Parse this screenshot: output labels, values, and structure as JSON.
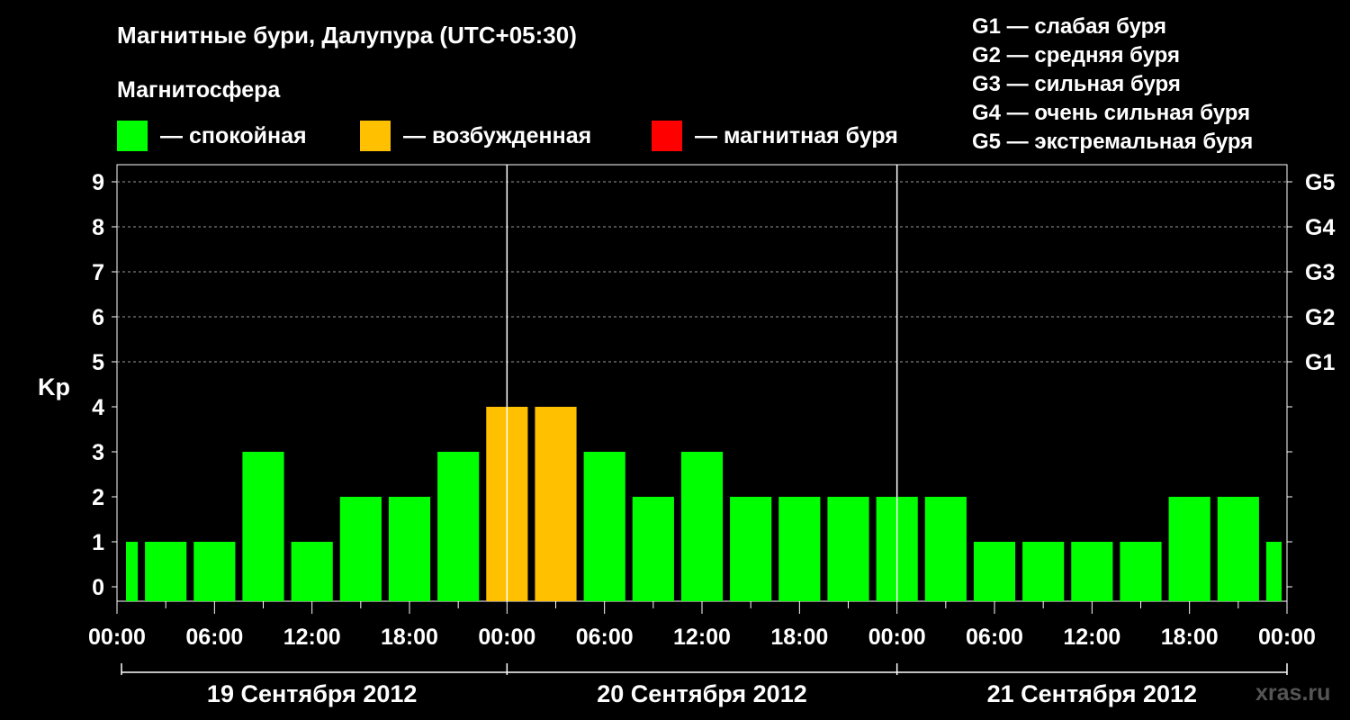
{
  "title": "Магнитные бури, Далупура (UTC+05:30)",
  "subtitle": "Магнитосфера",
  "legend": [
    {
      "label": "— спокойная",
      "color": "#00ff00"
    },
    {
      "label": "— возбужденная",
      "color": "#ffc000"
    },
    {
      "label": "— магнитная буря",
      "color": "#ff0000"
    }
  ],
  "g_legend": [
    "G1 — слабая буря",
    "G2 — средняя буря",
    "G3 — сильная буря",
    "G4 — очень сильная буря",
    "G5 — экстремальная буря"
  ],
  "watermark": "xras.ru",
  "chart_data": {
    "type": "bar",
    "ylabel": "Kp",
    "ylim": [
      0,
      9
    ],
    "yticks": [
      "0",
      "1",
      "2",
      "3",
      "4",
      "5",
      "6",
      "7",
      "8",
      "9"
    ],
    "right_axis": [
      {
        "kp": 5,
        "label": "G1"
      },
      {
        "kp": 6,
        "label": "G2"
      },
      {
        "kp": 7,
        "label": "G3"
      },
      {
        "kp": 8,
        "label": "G4"
      },
      {
        "kp": 9,
        "label": "G5"
      }
    ],
    "grid": "dashed at Kp 5-9",
    "x_range_hours": [
      0,
      72
    ],
    "xtick_labels": [
      "00:00",
      "06:00",
      "12:00",
      "18:00",
      "00:00",
      "06:00",
      "12:00",
      "18:00",
      "00:00",
      "06:00",
      "12:00",
      "18:00",
      "00:00"
    ],
    "days": [
      "19 Сентября 2012",
      "20 Сентября 2012",
      "21 Сентября 2012"
    ],
    "categories": [
      "19 Sep 00:00",
      "19 Sep 03:00",
      "19 Sep 06:00",
      "19 Sep 09:00",
      "19 Sep 12:00",
      "19 Sep 15:00",
      "19 Sep 18:00",
      "19 Sep 21:00",
      "20 Sep 00:00",
      "20 Sep 03:00",
      "20 Sep 06:00",
      "20 Sep 09:00",
      "20 Sep 12:00",
      "20 Sep 15:00",
      "20 Sep 18:00",
      "20 Sep 21:00",
      "21 Sep 00:00",
      "21 Sep 03:00",
      "21 Sep 06:00",
      "21 Sep 09:00",
      "21 Sep 12:00",
      "21 Sep 15:00",
      "21 Sep 18:00",
      "21 Sep 21:00",
      "22 Sep 00:00"
    ],
    "interval_start_hours": [
      -1.5,
      1.5,
      4.5,
      7.5,
      10.5,
      13.5,
      16.5,
      19.5,
      22.5,
      25.5,
      28.5,
      31.5,
      34.5,
      37.5,
      40.5,
      43.5,
      46.5,
      49.5,
      52.5,
      55.5,
      58.5,
      61.5,
      64.5,
      67.5,
      70.5
    ],
    "values": [
      1,
      1,
      1,
      3,
      1,
      2,
      2,
      3,
      4,
      4,
      3,
      2,
      3,
      2,
      2,
      2,
      2,
      2,
      1,
      1,
      1,
      1,
      2,
      2,
      1
    ],
    "colors": {
      "calm": "#00ff00",
      "active": "#ffc000",
      "storm": "#ff0000"
    }
  }
}
